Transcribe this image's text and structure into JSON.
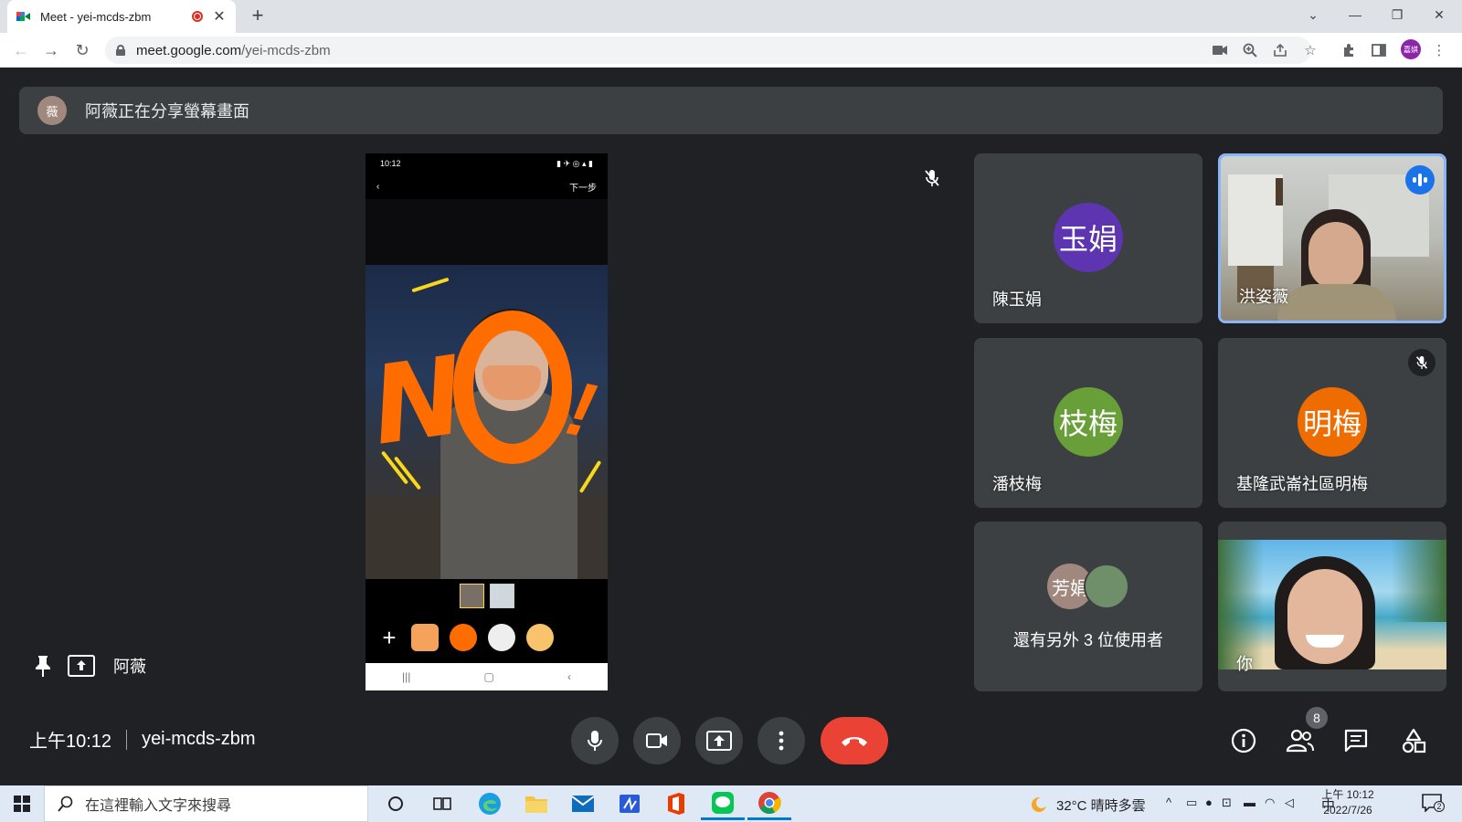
{
  "browser": {
    "tab_title": "Meet - yei-mcds-zbm",
    "url_host": "meet.google.com",
    "url_path": "/yei-mcds-zbm",
    "profile_initials": "嘉娸"
  },
  "banner": {
    "avatar_initial": "薇",
    "text": "阿薇正在分享螢幕畫面"
  },
  "screenshare": {
    "phone_time": "10:12",
    "next_label": "下一步"
  },
  "presenter": {
    "name": "阿薇"
  },
  "participants": [
    {
      "name": "陳玉娟",
      "initials": "玉娟",
      "color": "#5e35b1"
    },
    {
      "name": "洪姿薇",
      "speaking": true
    },
    {
      "name": "潘枝梅",
      "initials": "枝梅",
      "color": "#689f38"
    },
    {
      "name": "基隆武崙社區明梅",
      "initials": "明梅",
      "color": "#ef6c00",
      "muted": true
    },
    {
      "name": "還有另外 3 位使用者",
      "initials": "芳娟",
      "color": "#a1887f"
    },
    {
      "name": "你"
    }
  ],
  "meeting": {
    "time": "上午10:12",
    "code": "yei-mcds-zbm",
    "participant_count": "8"
  },
  "taskbar": {
    "search_placeholder": "在這裡輸入文字來搜尋",
    "weather": "32°C  晴時多雲",
    "ime": "中",
    "time": "上午 10:12",
    "date": "2022/7/26",
    "notification_count": "2"
  },
  "colors": {
    "meet_bg": "#202124",
    "tile_bg": "#3c4043",
    "end_call": "#ea4335",
    "speaking_blue": "#1a73e8",
    "highlight": "#8ab4f8"
  }
}
